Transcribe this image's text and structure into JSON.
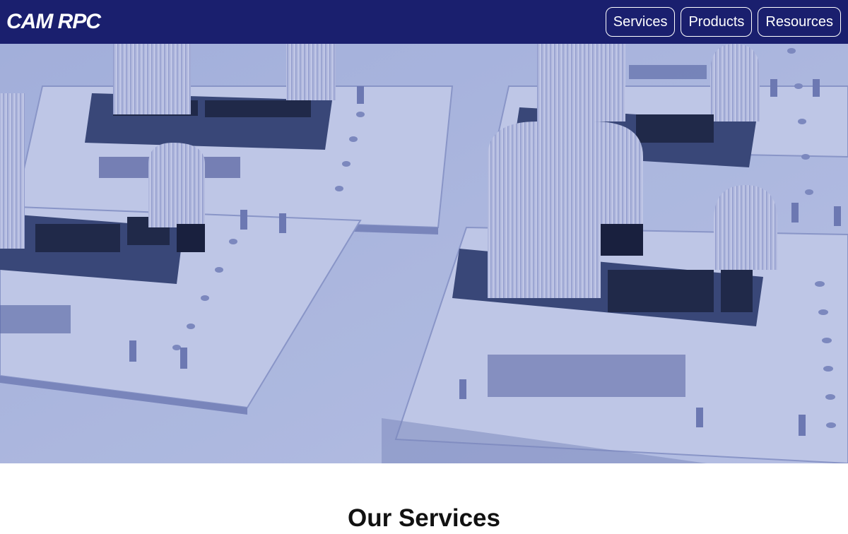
{
  "header": {
    "logo": "CAM RPC",
    "nav": [
      {
        "label": "Services"
      },
      {
        "label": "Products"
      },
      {
        "label": "Resources"
      }
    ]
  },
  "hero": {
    "image": "circuit-boards-with-ribbon-cables-photo",
    "tint_color": "#2b3fa8"
  },
  "main": {
    "section_title": "Our Services"
  },
  "colors": {
    "navbar": "#1a1f6e",
    "nav_text": "#ffffff",
    "title_text": "#111111"
  }
}
